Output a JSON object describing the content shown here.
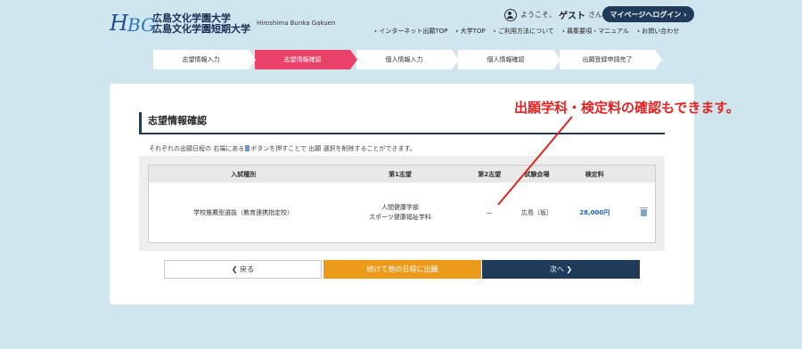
{
  "header": {
    "logo_mark_h": "H",
    "logo_mark_bg": "BG",
    "university_name_1": "広島文化学園大学",
    "university_name_2": "広島文化学園短期大学",
    "english_name": "Hiroshima Bunka Gakuen",
    "welcome_prefix": "ようこそ、",
    "welcome_user": "ゲスト",
    "welcome_suffix": "さん",
    "mypage_login": "マイページへログイン ›",
    "nav": [
      "インターネット出願TOP",
      "大学TOP",
      "ご利用方法について",
      "募集要項・マニュアル",
      "お問い合わせ"
    ]
  },
  "steps": [
    {
      "label": "志望情報入力",
      "active": false
    },
    {
      "label": "志望情報確認",
      "active": true
    },
    {
      "label": "個人情報入力",
      "active": false
    },
    {
      "label": "個人情報確認",
      "active": false
    },
    {
      "label": "出願登録申請完了",
      "active": false
    }
  ],
  "main": {
    "title": "志望情報確認",
    "note_before": "それぞれの出願日程の 右端にある",
    "note_after": "ボタンを押すことで 出願 選択を削除することができます。",
    "table": {
      "headers": [
        "入試種別",
        "第1志望",
        "第2志望",
        "試験会場",
        "検定料"
      ],
      "rows": [
        {
          "exam_type": "学校推薦型選抜（教育連携指定校）",
          "first_choice_line1": "人間健康学部",
          "first_choice_line2": "スポーツ健康福祉学科",
          "second_choice": "—",
          "venue": "広島（坂）",
          "fee": "28,000円"
        }
      ]
    },
    "buttons": {
      "back": "❮ 戻る",
      "continue": "続けて他の日程に出願",
      "next": "次へ ❯"
    }
  },
  "annotation": "出願学科・検定料の確認もできます。",
  "colors": {
    "background": "#cfe6ef",
    "active_step": "#e94268",
    "navy": "#203a5a",
    "orange": "#eb9a1a",
    "annotation_red": "#e42222",
    "fee_blue": "#1f5fb3"
  }
}
